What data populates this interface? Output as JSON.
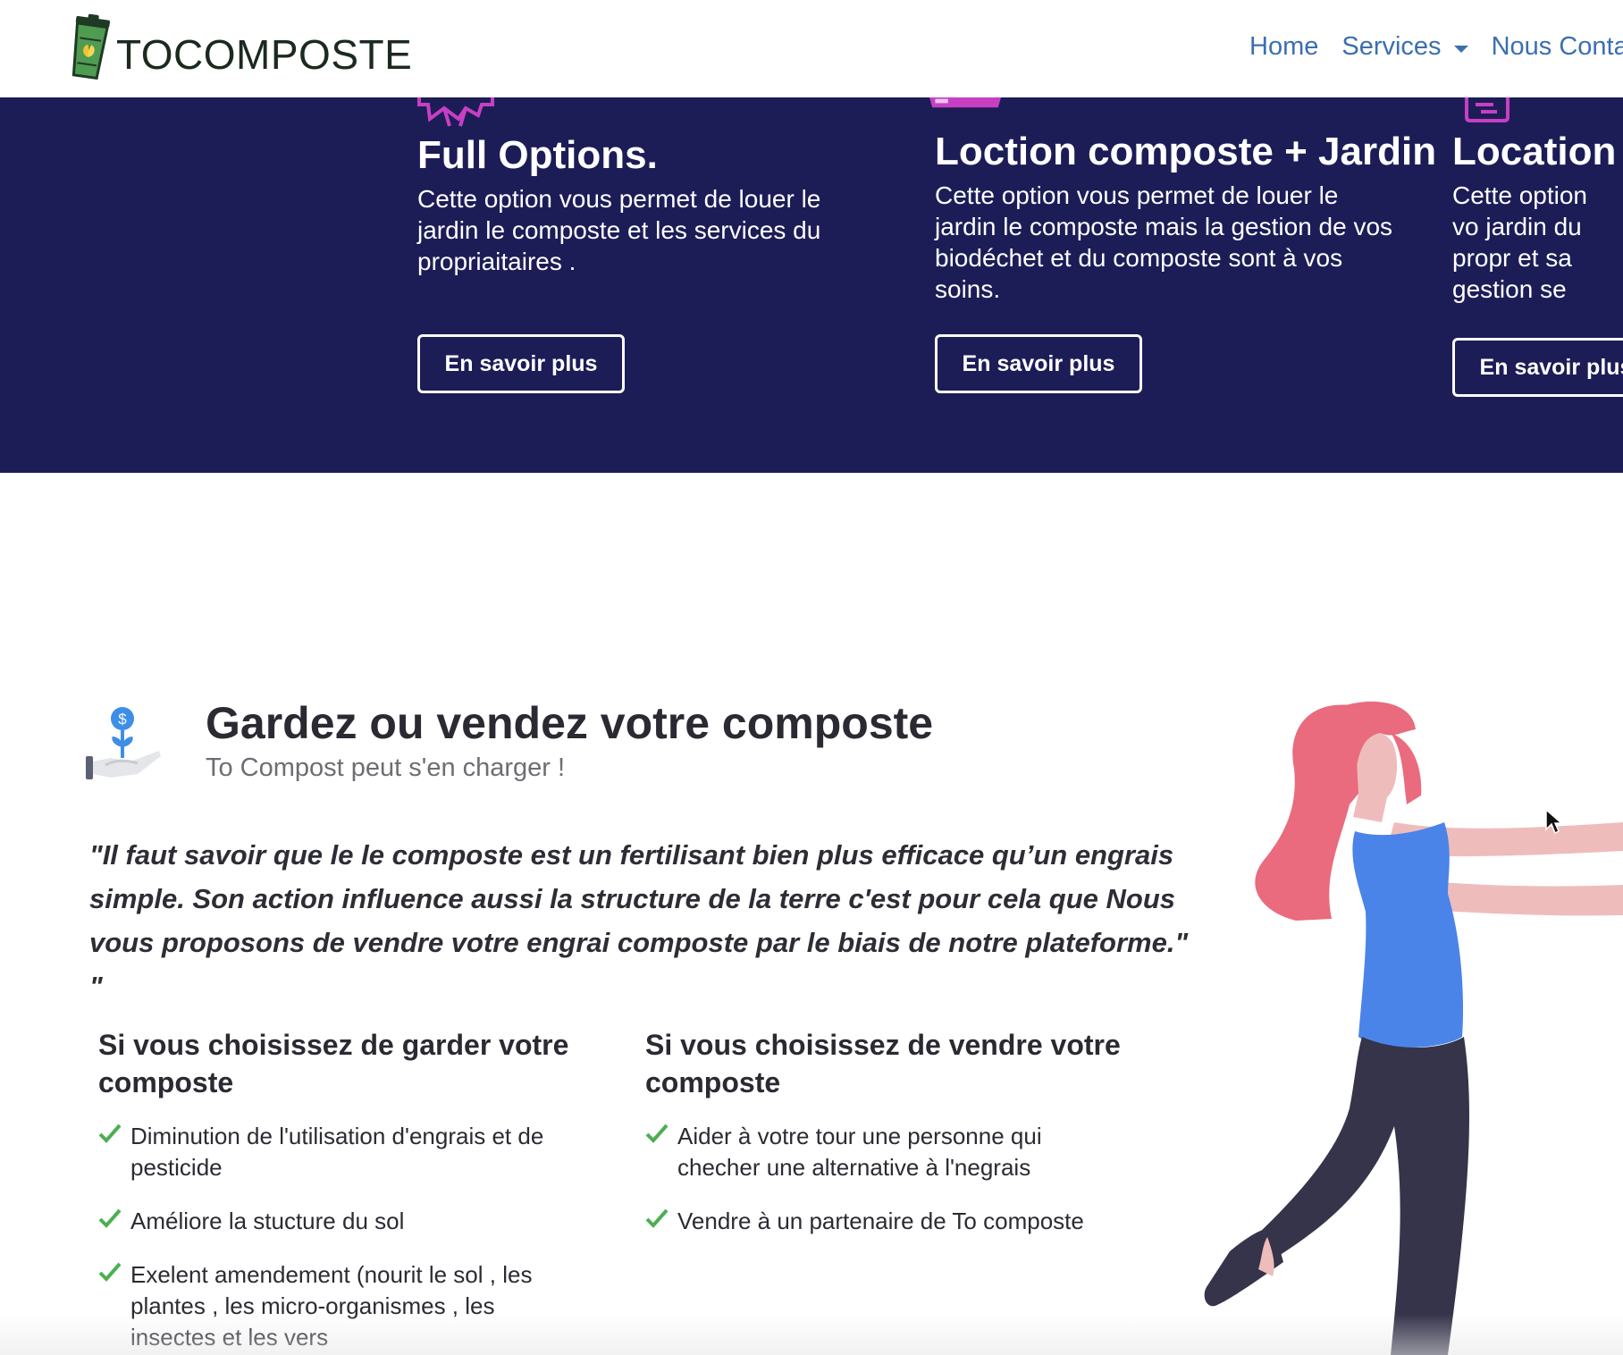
{
  "navbar": {
    "brand": "TOCOMPOSTE",
    "links": [
      {
        "label": "Home"
      },
      {
        "label": "Services"
      },
      {
        "label": "Nous Conta"
      }
    ]
  },
  "services": {
    "cards": [
      {
        "title": "Full Options.",
        "description": "Cette option vous permet de louer le jardin le composte et les services du propriaitaires .",
        "button": "En savoir plus"
      },
      {
        "title": "Loction composte + Jardin",
        "description": "Cette option vous permet de louer le jardin le composte mais la gestion de vos biodéchet et du composte sont à vos soins.",
        "button": "En savoir plus"
      },
      {
        "title": "Location c",
        "description": "Cette option vo jardin du propr et sa gestion se",
        "button": "En savoir plus"
      }
    ]
  },
  "compost": {
    "title": "Gardez ou vendez votre composte",
    "subtitle": "To Compost peut s'en charger !",
    "quote": "\"Il faut savoir que le le composte est un fertilisant bien plus efficace qu’un engrais simple. Son action influence aussi la structure de la terre c'est pour cela que Nous vous proposons de vendre votre engrai composte par le biais de notre plateforme.\" \"",
    "keep": {
      "title": "Si vous choisissez de garder votre composte",
      "items": [
        "Diminution de l'utilisation d'engrais et de pesticide",
        "Améliore la stucture du sol",
        "Exelent amendement (nourit le sol , les plantes , les micro-organismes , les insectes et les vers"
      ]
    },
    "sell": {
      "title": "Si vous choisissez de vendre votre composte",
      "items": [
        "Aider à votre tour une personne qui checher une alternative à l'negrais",
        "Vendre à un partenaire de To composte"
      ]
    }
  },
  "colors": {
    "navy": "#1c1d57",
    "link": "#3b6fb0",
    "check": "#4caf50",
    "magenta": "#c83fc3"
  },
  "icons": {
    "brand": "compost-bin-icon",
    "service_1": "badge-icon",
    "service_2": "compost-pile-icon",
    "service_3": "card-icon",
    "compost": "money-plant-hand-icon",
    "check": "check-icon"
  }
}
